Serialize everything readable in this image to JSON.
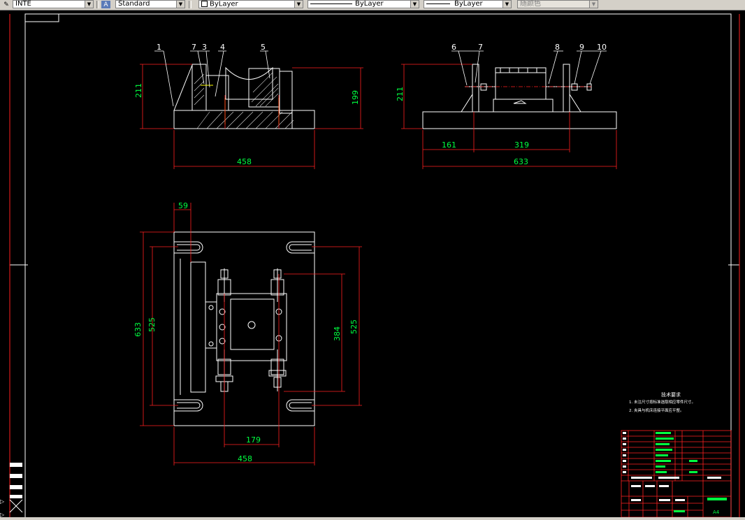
{
  "toolbar": {
    "linetype": "INTE",
    "text_style": "Standard",
    "layer": "ByLayer",
    "linetype_combo": "ByLayer",
    "lineweight_combo": "ByLayer",
    "color_combo": "随颜色"
  },
  "views": {
    "front": {
      "parts": [
        "1",
        "7",
        "3",
        "4",
        "5"
      ],
      "dim_height": "211",
      "dim_right": "199",
      "dim_width": "458"
    },
    "side": {
      "parts": [
        "6",
        "7",
        "8",
        "9",
        "10"
      ],
      "dim_height": "211",
      "dim_161": "161",
      "dim_319": "319",
      "dim_633": "633"
    },
    "top": {
      "dim_59": "59",
      "dim_633": "633",
      "dim_525_left": "525",
      "dim_384": "384",
      "dim_525_right": "525",
      "dim_179": "179",
      "dim_458": "458"
    }
  },
  "notes": {
    "title": "技术要求",
    "line1": "1. 未注尺寸按标准选取相应零件尺寸。",
    "line2": "2. 夹具与机床连接平面应平整。"
  },
  "title_block": {
    "sheet": "A4"
  }
}
